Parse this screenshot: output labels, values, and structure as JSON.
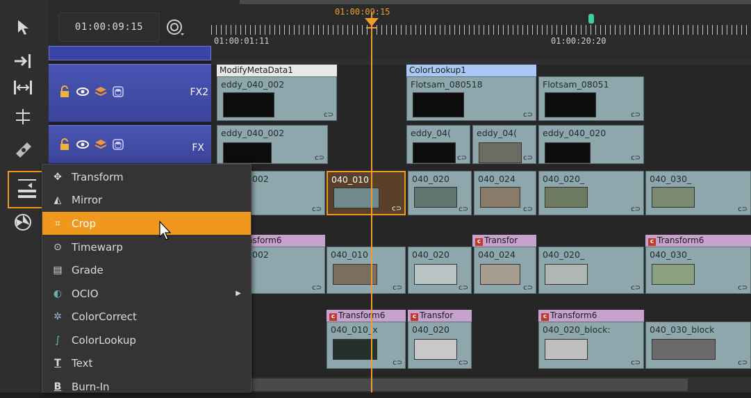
{
  "header": {
    "timecode": "01:00:09:15"
  },
  "ruler": {
    "playhead_label": "01:00:09:15",
    "start_label": "01:00:01:11",
    "mid_label": "01:00:20:20"
  },
  "tracks": {
    "fx2_label": "FX2",
    "fx_label": "FX"
  },
  "clips": {
    "modify_meta": "ModifyMetaData1",
    "colorlookup": "ColorLookup1",
    "r1": [
      "eddy_040_002",
      "Flotsam_080518",
      "Flotsam_08051"
    ],
    "r2": [
      "eddy_040_002",
      "eddy_04(",
      "eddy_04(",
      "eddy_040_020"
    ],
    "r3": [
      "002",
      "040_010",
      "040_020",
      "040_024",
      "040_020_",
      "040_030_"
    ],
    "r4_fx": [
      "nsform6",
      "Transfor",
      "Transform6"
    ],
    "r4": [
      "002",
      "040_010",
      "040_020",
      "040_024",
      "040_020_",
      "040_030_"
    ],
    "r5_fx": [
      "Transform6",
      "Transfor",
      "Transform6"
    ],
    "r5": [
      "040_010_x",
      "040_020",
      "040_020_block:",
      "040_030_block"
    ]
  },
  "menu": {
    "items": [
      {
        "label": "Transform",
        "icon": "transform-icon"
      },
      {
        "label": "Mirror",
        "icon": "mirror-icon"
      },
      {
        "label": "Crop",
        "icon": "crop-icon"
      },
      {
        "label": "Timewarp",
        "icon": "timewarp-icon"
      },
      {
        "label": "Grade",
        "icon": "grade-icon"
      },
      {
        "label": "OCIO",
        "icon": "ocio-icon"
      },
      {
        "label": "ColorCorrect",
        "icon": "colorcorrect-icon"
      },
      {
        "label": "ColorLookup",
        "icon": "colorlookup-icon"
      },
      {
        "label": "Text",
        "icon": "text-icon"
      },
      {
        "label": "Burn-In",
        "icon": "burnin-icon"
      }
    ],
    "selected_label": "Crop"
  },
  "colors": {
    "accent": "#f0971e",
    "track_header": "#3f4aa8",
    "clip": "#8ea7ac",
    "fx_clip": "#c8a2cf",
    "menu_bg": "#343434"
  }
}
